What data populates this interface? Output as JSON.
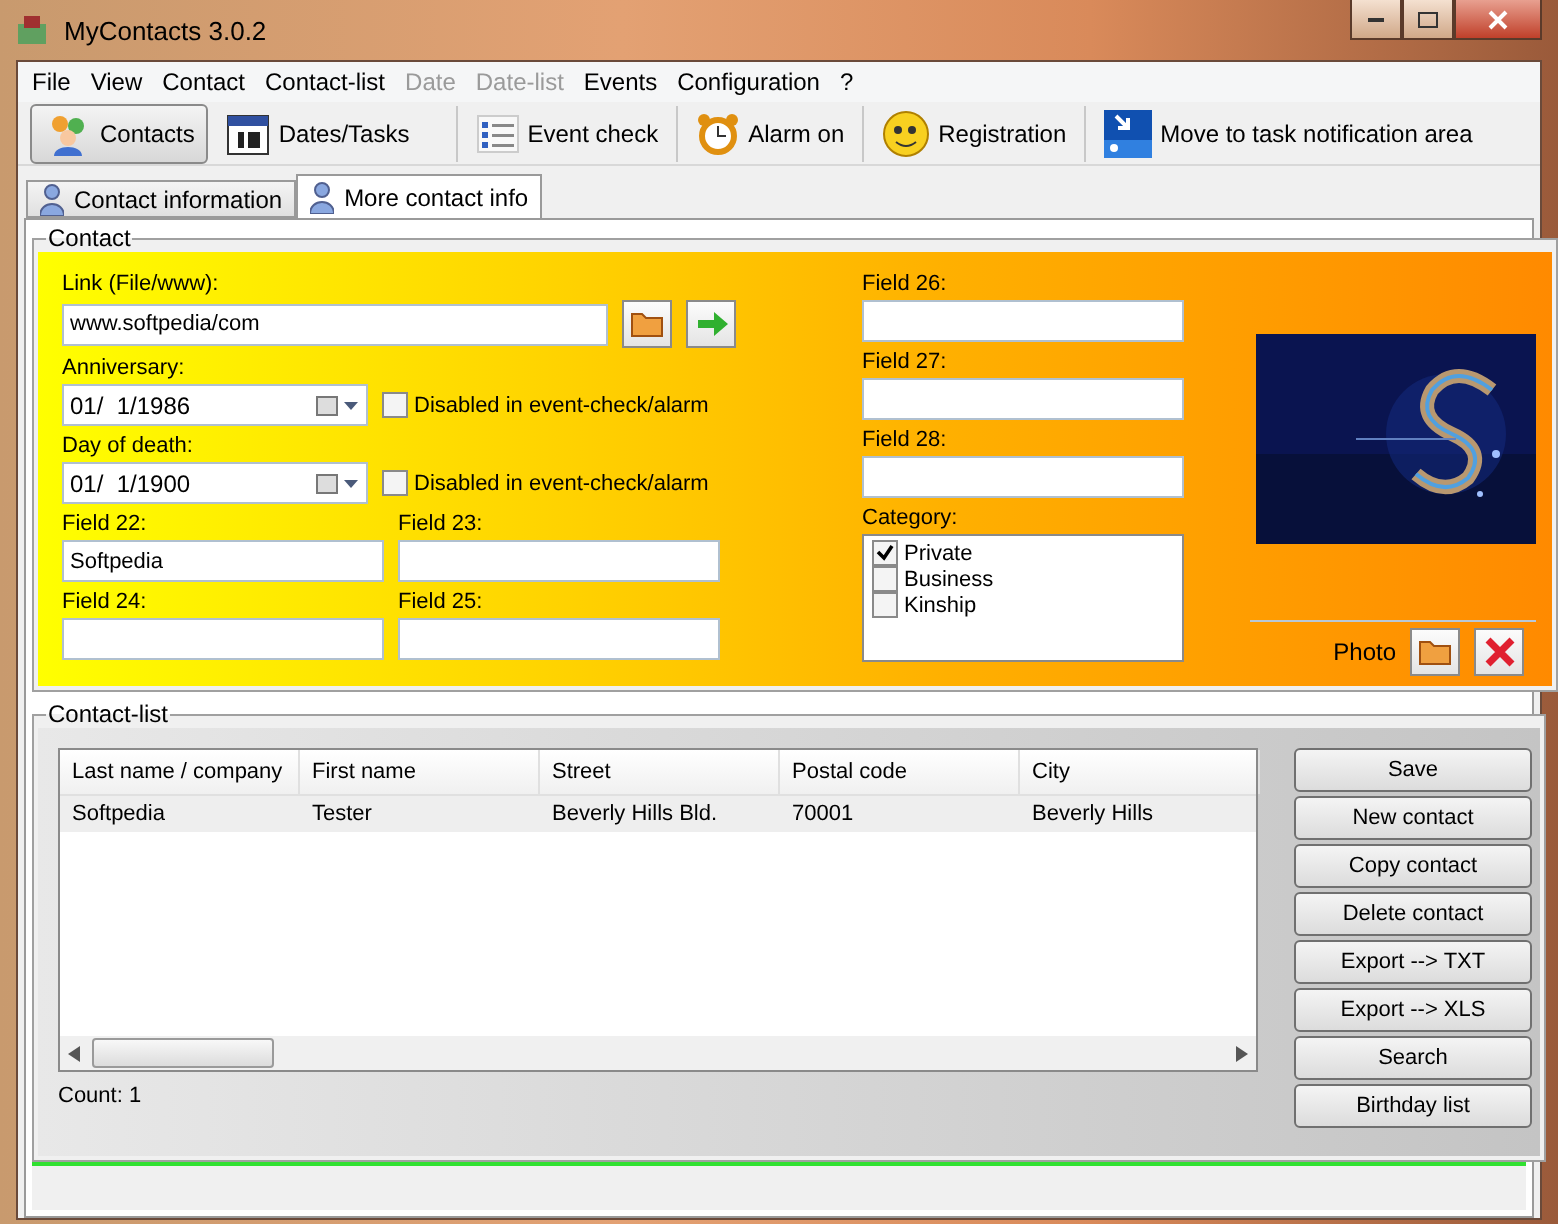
{
  "window": {
    "title": "MyContacts 3.0.2"
  },
  "menu": [
    {
      "label": "File",
      "disabled": false
    },
    {
      "label": "View",
      "disabled": false
    },
    {
      "label": "Contact",
      "disabled": false
    },
    {
      "label": "Contact-list",
      "disabled": false
    },
    {
      "label": "Date",
      "disabled": true
    },
    {
      "label": "Date-list",
      "disabled": true
    },
    {
      "label": "Events",
      "disabled": false
    },
    {
      "label": "Configuration",
      "disabled": false
    },
    {
      "label": "?",
      "disabled": false
    }
  ],
  "toolbar": [
    {
      "label": "Contacts",
      "kind": "contacts",
      "selected": true
    },
    {
      "label": "Dates/Tasks",
      "kind": "calendar",
      "selected": false
    },
    {
      "label": "Event check",
      "kind": "list",
      "selected": false
    },
    {
      "label": "Alarm on",
      "kind": "alarm",
      "selected": false
    },
    {
      "label": "Registration",
      "kind": "smiley",
      "selected": false
    },
    {
      "label": "Move to task notification area",
      "kind": "tray",
      "selected": false
    }
  ],
  "tabs": [
    {
      "label": "Contact information",
      "selected": false
    },
    {
      "label": "More contact info",
      "selected": true
    }
  ],
  "contact": {
    "title": "Contact",
    "link": {
      "label": "Link  (File/www):",
      "value": "www.softpedia/com"
    },
    "dates": [
      {
        "label": "Anniversary:",
        "value": "01/  1/1986",
        "checkbox": {
          "label": "Disabled in event-check/alarm",
          "checked": false
        }
      },
      {
        "label": "Day of death:",
        "value": "01/  1/1900",
        "checkbox": {
          "label": "Disabled in event-check/alarm",
          "checked": false
        }
      }
    ],
    "fields": [
      {
        "label": "Field 22:",
        "value": "Softpedia"
      },
      {
        "label": "Field 23:"
      },
      {
        "label": "Field 24:"
      },
      {
        "label": "Field 25:"
      }
    ],
    "right_fields": [
      {
        "label": "Field 26:"
      },
      {
        "label": "Field 27:"
      },
      {
        "label": "Field 28:"
      }
    ],
    "category": {
      "label": "Category:",
      "items": [
        {
          "label": "Private",
          "checked": true
        },
        {
          "label": "Business",
          "checked": false
        },
        {
          "label": "Kinship",
          "checked": false
        }
      ]
    },
    "photo": {
      "label": "Photo"
    }
  },
  "contact_list": {
    "title": "Contact-list",
    "columns": [
      "Last name / company",
      "First name",
      "Street",
      "Postal code",
      "City"
    ],
    "rows": [
      [
        "Softpedia",
        "Tester",
        "Beverly Hills Bld.",
        "70001",
        "Beverly Hills"
      ]
    ],
    "count": "Count: 1"
  },
  "buttons": [
    "Save",
    "New contact",
    "Copy contact",
    "Delete contact",
    "Export --> TXT",
    "Export --> XLS",
    "Search",
    "Birthday list"
  ]
}
